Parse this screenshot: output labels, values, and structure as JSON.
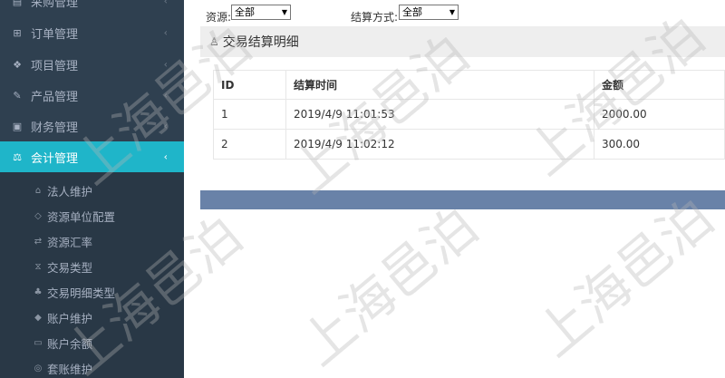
{
  "sidebar": {
    "items": [
      {
        "label": "采购管理",
        "icon": "cart-icon",
        "glyph": "▤"
      },
      {
        "label": "订单管理",
        "icon": "cart-icon",
        "glyph": "⊞"
      },
      {
        "label": "项目管理",
        "icon": "cubes-icon",
        "glyph": "❖"
      },
      {
        "label": "产品管理",
        "icon": "edit-icon",
        "glyph": "✎"
      },
      {
        "label": "财务管理",
        "icon": "money-icon",
        "glyph": "▣"
      },
      {
        "label": "会计管理",
        "icon": "balance-scale-icon",
        "glyph": "⚖"
      }
    ],
    "chevron": "‹",
    "sub_items": [
      {
        "label": "法人维护",
        "icon": "bank-icon",
        "glyph": "⌂"
      },
      {
        "label": "资源单位配置",
        "icon": "diamond-icon",
        "glyph": "◇"
      },
      {
        "label": "资源汇率",
        "icon": "exchange-icon",
        "glyph": "⇄"
      },
      {
        "label": "交易类型",
        "icon": "hourglass-icon",
        "glyph": "⧖"
      },
      {
        "label": "交易明细类型",
        "icon": "paw-icon",
        "glyph": "♣"
      },
      {
        "label": "账户维护",
        "icon": "tag-icon",
        "glyph": "◆"
      },
      {
        "label": "账户余额",
        "icon": "credit-card-icon",
        "glyph": "▭"
      },
      {
        "label": "套账维护",
        "icon": "life-ring-icon",
        "glyph": "◎"
      }
    ]
  },
  "filters": {
    "resource_label": "资源:",
    "resource_value": "全部",
    "settle_label": "结算方式:",
    "settle_value": "全部",
    "arrow": "▼"
  },
  "panel": {
    "title": "交易结算明细",
    "icon": "user-icon",
    "glyph": "♙"
  },
  "table": {
    "headers": [
      "ID",
      "结算时间",
      "金额"
    ],
    "rows": [
      [
        "1",
        "2019/4/9 11:01:53",
        "2000.00"
      ],
      [
        "2",
        "2019/4/9 11:02:12",
        "300.00"
      ]
    ]
  },
  "watermark": "上海邑泊",
  "colors": {
    "sidebar_bg": "#2f4050",
    "active_bg": "#1fb5c9",
    "bar": "#6982a8"
  }
}
